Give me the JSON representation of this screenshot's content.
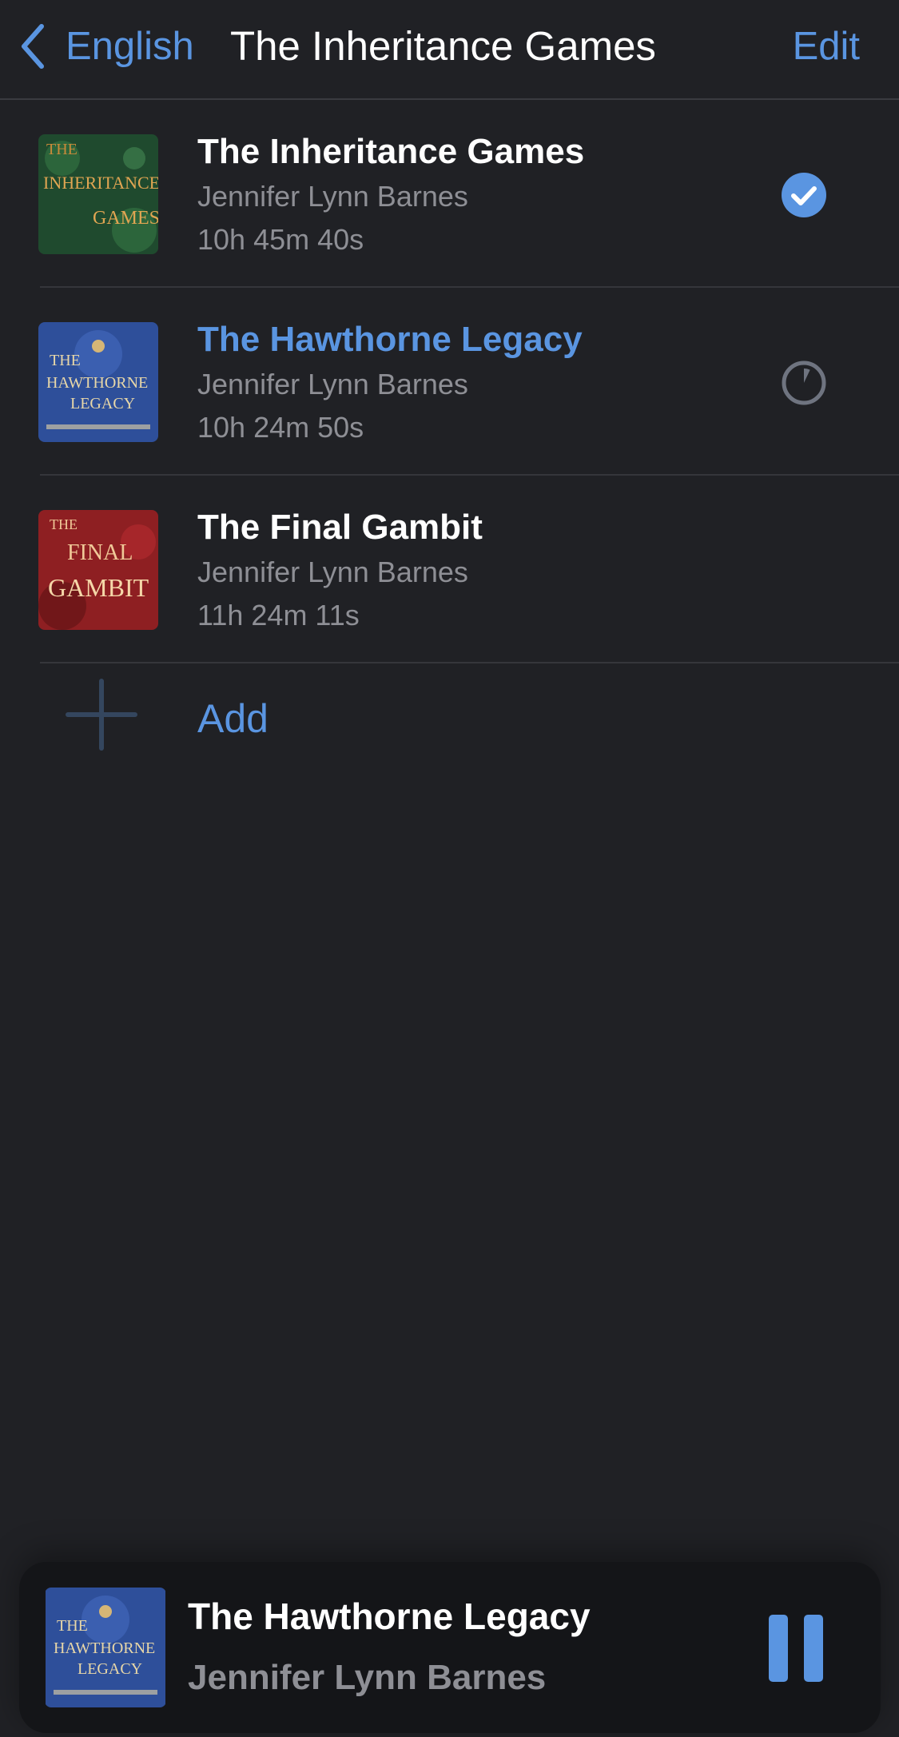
{
  "nav": {
    "back_label": "English",
    "title": "The Inheritance Games",
    "edit_label": "Edit"
  },
  "books": [
    {
      "title": "The Inheritance Games",
      "author": "Jennifer Lynn Barnes",
      "duration": "10h 45m 40s",
      "status": "finished",
      "status_icon": "checkmark-circle-icon",
      "cover_text": [
        "THE",
        "INHERITANCE",
        "GAMES"
      ],
      "cover_colors": [
        "#1f4a2e",
        "#c88a3a"
      ]
    },
    {
      "title": "The Hawthorne Legacy",
      "author": "Jennifer Lynn Barnes",
      "duration": "10h 24m 50s",
      "status": "in-progress",
      "status_icon": "progress-circle-icon",
      "progress": 0.07,
      "cover_text": [
        "THE",
        "HAWTHORNE",
        "LEGACY"
      ],
      "cover_colors": [
        "#2e4f9a",
        "#e8d7a8"
      ]
    },
    {
      "title": "The Final Gambit",
      "author": "Jennifer Lynn Barnes",
      "duration": "11h 24m 11s",
      "status": "none",
      "cover_text": [
        "THE",
        "FINAL",
        "GAMBIT"
      ],
      "cover_colors": [
        "#8e1f22",
        "#f0c998"
      ]
    }
  ],
  "add": {
    "label": "Add",
    "icon": "plus-icon"
  },
  "now_playing": {
    "title": "The Hawthorne Legacy",
    "author": "Jennifer Lynn Barnes",
    "control_icon": "pause-icon"
  },
  "colors": {
    "background": "#202125",
    "accent": "#5a95e1",
    "secondary_text": "#8e8f95",
    "mini_player_bg": "#141518"
  }
}
